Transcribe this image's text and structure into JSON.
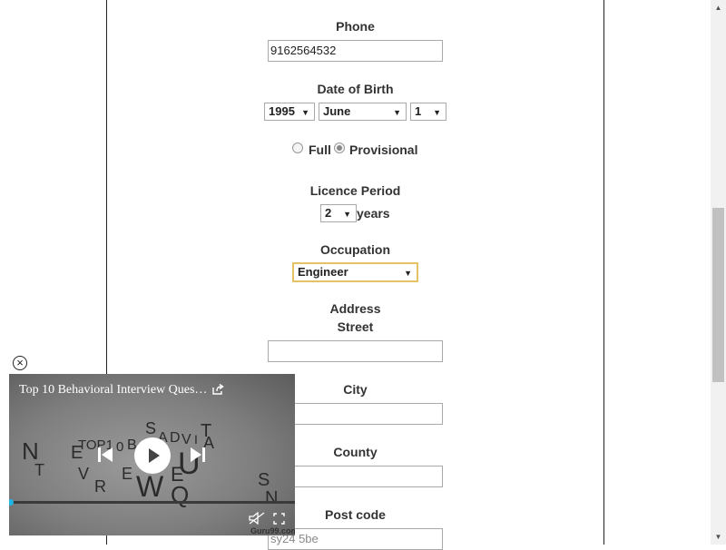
{
  "form": {
    "phone": {
      "label": "Phone",
      "value": "9162564532"
    },
    "date_of_birth": {
      "label": "Date of Birth",
      "year": "1995",
      "month": "June",
      "day": "1"
    },
    "licence_type": {
      "options": [
        {
          "label": "Full",
          "checked": false
        },
        {
          "label": "Provisional",
          "checked": true
        }
      ]
    },
    "licence_period": {
      "label": "Licence Period",
      "value": "2",
      "unit": "years"
    },
    "occupation": {
      "label": "Occupation",
      "value": "Engineer"
    },
    "address": {
      "label": "Address",
      "street": {
        "label": "Street",
        "value": ""
      },
      "city": {
        "label": "City",
        "value": ""
      },
      "county": {
        "label": "County",
        "value": ""
      },
      "post_code": {
        "label": "Post code",
        "value": "sy24 5be"
      }
    }
  },
  "video": {
    "title": "Top 10 Behavioral Interview Ques…",
    "progress": 0.0,
    "watermark": "Guru99.com",
    "art_letters": [
      "N",
      "T",
      "E",
      "V",
      "R",
      "TOP1",
      "0",
      "B",
      "E",
      "S",
      "A",
      "D",
      "V",
      "I",
      "W",
      "E",
      "Q",
      "U",
      "T",
      "A",
      "S",
      "N"
    ]
  },
  "colors": {
    "focus_border": "#e5c365",
    "progress_knob": "#1fb6ea",
    "scroll_thumb": "#c1c1c1"
  }
}
